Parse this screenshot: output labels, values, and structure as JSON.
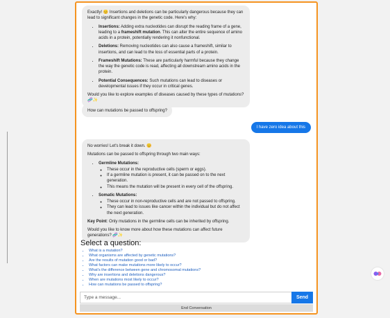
{
  "messages": {
    "bot1": {
      "intro": "Exactly! 😊 Insertions and deletions can be particularly dangerous because they can lead to significant changes in the genetic code. Here's why:",
      "items": [
        {
          "title": "Insertions:",
          "text": " Adding extra nucleotides can disrupt the reading frame of a gene, leading to a ",
          "bold2": "frameshift mutation",
          "text2": ". This can alter the entire sequence of amino acids in a protein, potentially rendering it nonfunctional."
        },
        {
          "title": "Deletions:",
          "text": " Removing nucleotides can also cause a frameshift, similar to insertions, and can lead to the loss of essential parts of a protein."
        },
        {
          "title": "Frameshift Mutations:",
          "text": " These are particularly harmful because they change the way the genetic code is read, affecting all downstream amino acids in the protein."
        },
        {
          "title": "Potential Consequences:",
          "text": " Such mutations can lead to diseases or developmental issues if they occur in critical genes."
        }
      ],
      "outro": "Would you like to explore examples of diseases caused by these types of mutations? 🧬✨"
    },
    "bot2": "How can mutations be passed to offspring?",
    "user1": "I have zero idea about this",
    "bot3": {
      "intro": "No worries! Let's break it down. 😊",
      "lead": "Mutations can be passed to offspring through two main ways:",
      "germline_title": "Germline Mutations:",
      "germline_items": [
        "These occur in the reproductive cells (sperm or eggs).",
        "If a germline mutation is present, it can be passed on to the next generation.",
        "This means the mutation will be present in every cell of the offspring."
      ],
      "somatic_title": "Somatic Mutations:",
      "somatic_items": [
        "These occur in non-reproductive cells and are not passed to offspring.",
        "They can lead to issues like cancer within the individual but do not affect the next generation."
      ],
      "key_label": "Key Point",
      "key_text": ": Only mutations in the germline cells can be inherited by offspring.",
      "outro": "Would you like to know more about how these mutations can affect future generations? 🧬✨"
    }
  },
  "questions": {
    "title": "Select a question:",
    "items": [
      "What is a mutation?",
      "What organisms are affected by genetic mutations?",
      "Are the results of mutation good or bad?",
      "What factors can make mutations more likely to occur?",
      "What's the difference between gene and chromosomal mutations?",
      "Why are insertions and deletions dangerous?",
      "When are mutations most likely to occur?",
      "How can mutations be passed to offspring?"
    ]
  },
  "composer": {
    "placeholder": "Type a message...",
    "send_label": "Send",
    "end_label": "End Conversation"
  },
  "colors": {
    "accent": "#1677e8",
    "frame": "#f5931f",
    "bubble": "#ececec"
  },
  "icons": {
    "floating": "assistant-widget-icon"
  }
}
